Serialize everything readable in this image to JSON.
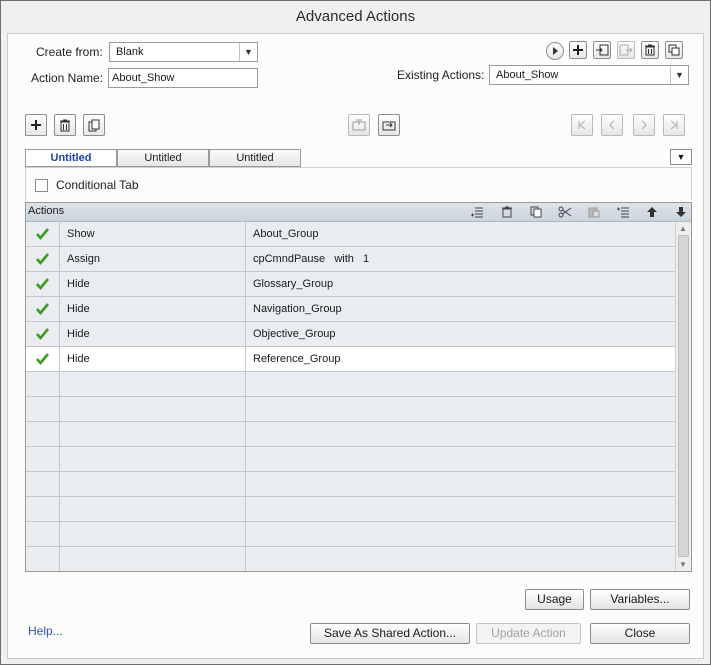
{
  "window": {
    "title": "Advanced Actions"
  },
  "form": {
    "create_from_label": "Create from:",
    "create_from_value": "Blank",
    "action_name_label": "Action Name:",
    "action_name_value": "About_Show",
    "existing_actions_label": "Existing Actions:",
    "existing_actions_value": "About_Show"
  },
  "tabs": [
    {
      "label": "Untitled",
      "active": true
    },
    {
      "label": "Untitled",
      "active": false
    },
    {
      "label": "Untitled",
      "active": false
    }
  ],
  "conditional": {
    "label": "Conditional Tab",
    "checked": false
  },
  "actions": {
    "header": "Actions",
    "rows": [
      {
        "action": "Show",
        "target": "About_Group",
        "enabled": true
      },
      {
        "action": "Assign",
        "target": "cpCmndPause   with   1",
        "enabled": true
      },
      {
        "action": "Hide",
        "target": "Glossary_Group",
        "enabled": true
      },
      {
        "action": "Hide",
        "target": "Navigation_Group",
        "enabled": true
      },
      {
        "action": "Hide",
        "target": "Objective_Group",
        "enabled": true
      },
      {
        "action": "Hide",
        "target": "Reference_Group",
        "enabled": true
      }
    ]
  },
  "buttons": {
    "usage": "Usage",
    "variables": "Variables...",
    "help": "Help...",
    "save_shared": "Save As Shared Action...",
    "update": "Update Action",
    "close": "Close"
  },
  "colors": {
    "check": "#3a9c1a",
    "link": "#2d55a8",
    "active_tab": "#1f3fa8"
  }
}
